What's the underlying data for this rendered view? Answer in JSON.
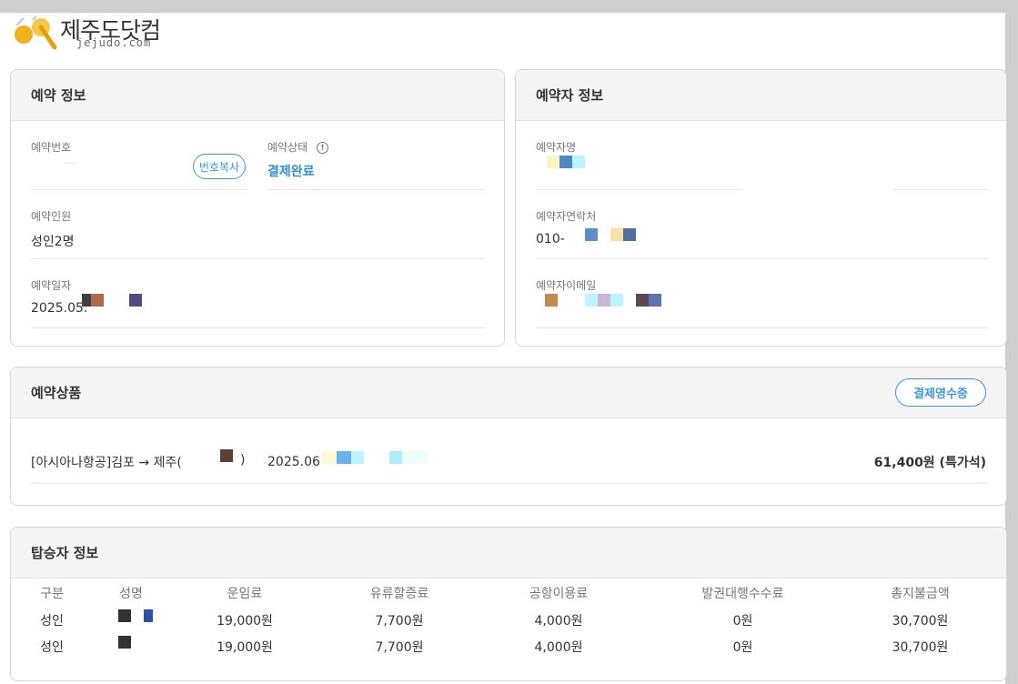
{
  "logo": {
    "title": "제주도닷컴",
    "subtitle": "jejudo.com"
  },
  "reservation_info": {
    "title": "예약 정보",
    "number_label": "예약번호",
    "copy_button": "번호복사",
    "status_label": "예약상태",
    "status_info_icon": "info-icon",
    "status_value": "결제완료",
    "people_label": "예약인원",
    "people_value": "성인2명",
    "date_label": "예약일자",
    "date_value": "2025.05."
  },
  "booker_info": {
    "title": "예약자 정보",
    "name_label": "예약자명",
    "phone_label": "예약자연락처",
    "phone_value": "010-",
    "email_label": "예약자이메일"
  },
  "product": {
    "title": "예약상품",
    "receipt_button": "결제영수증",
    "route": "[아시아나항공]김포 → 제주(",
    "route_close": ")",
    "date": "2025.06",
    "price": "61,400원 (특가석)"
  },
  "passengers": {
    "title": "탑승자 정보",
    "columns": [
      "구분",
      "성명",
      "운임료",
      "유류할증료",
      "공항이용료",
      "발권대행수수료",
      "총지불금액"
    ],
    "rows": [
      [
        "성인",
        "",
        "19,000원",
        "7,700원",
        "4,000원",
        "0원",
        "30,700원"
      ],
      [
        "성인",
        "",
        "19,000원",
        "7,700원",
        "4,000원",
        "0원",
        "30,700원"
      ]
    ]
  },
  "colors": {
    "accent": "#3d97dc",
    "status": "#2f8fd8"
  }
}
